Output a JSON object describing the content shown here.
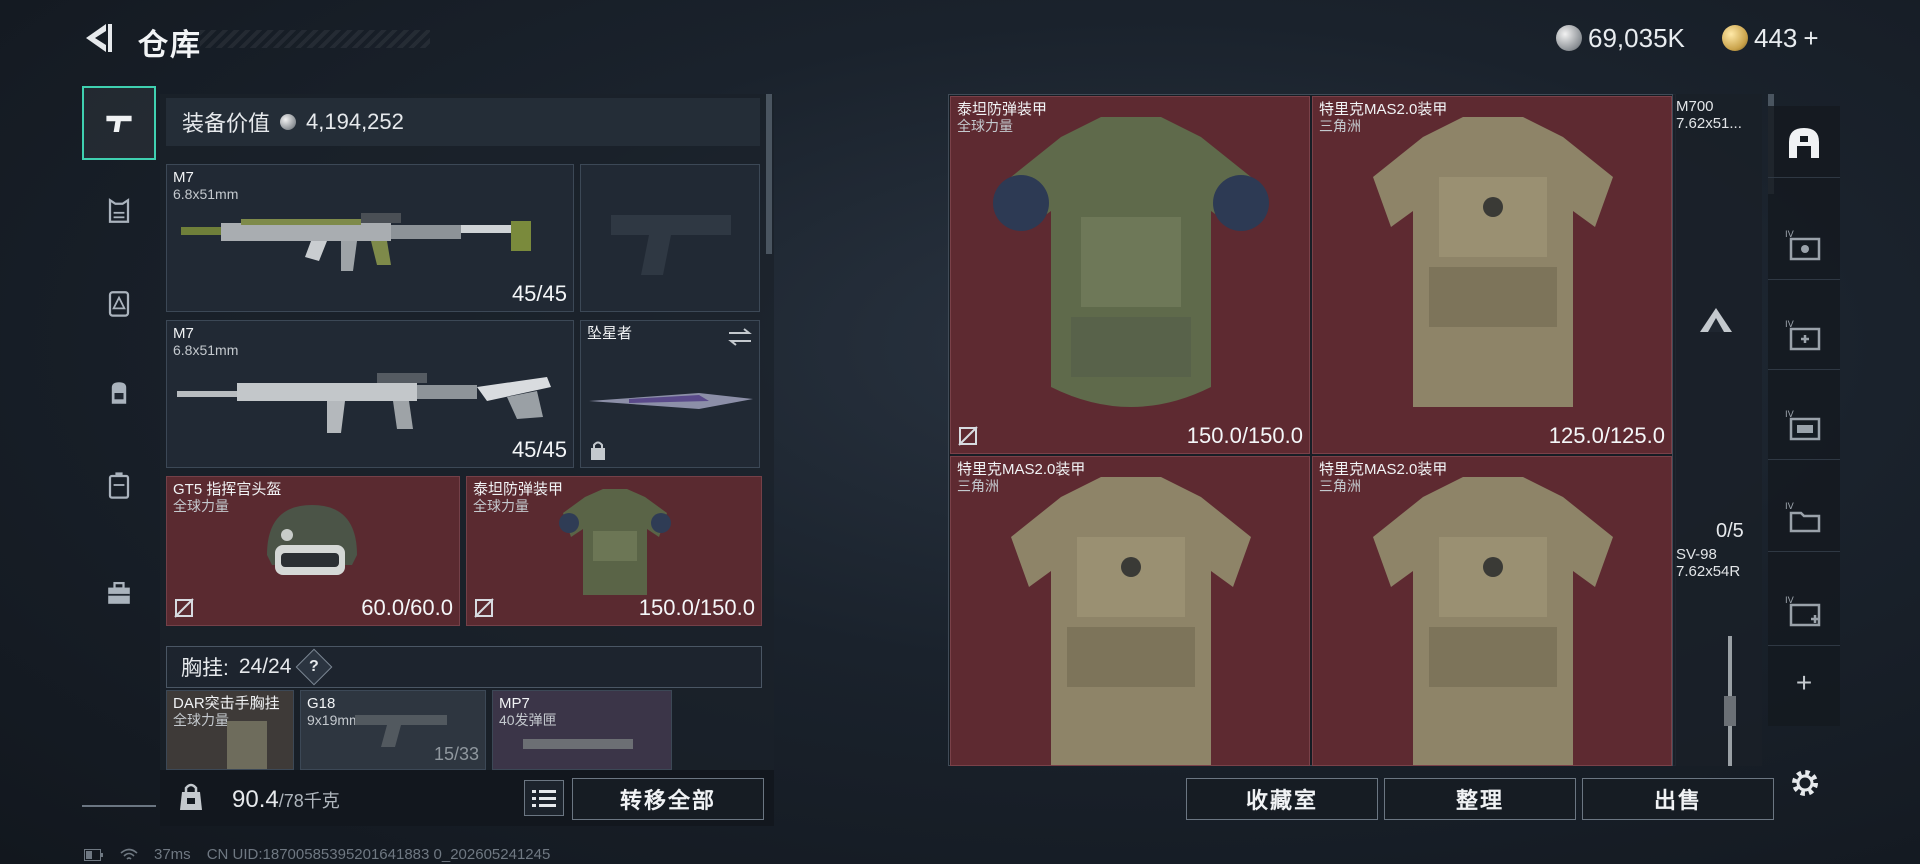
{
  "header": {
    "title": "仓库",
    "silver_currency": "69,035K",
    "gold_currency": "443",
    "gold_add": "+"
  },
  "nav": {
    "items": [
      {
        "name": "weapons",
        "active": true
      },
      {
        "name": "armor"
      },
      {
        "name": "vest"
      },
      {
        "name": "backpack"
      },
      {
        "name": "container"
      },
      {
        "name": "toolbox"
      }
    ]
  },
  "loadout": {
    "equip_value_label": "装备价值",
    "equip_value": "4,194,252",
    "primary1": {
      "name": "M7",
      "caliber": "6.8x51mm",
      "ammo": "45/45"
    },
    "primary2": {
      "name": "M7",
      "caliber": "6.8x51mm",
      "ammo": "45/45"
    },
    "melee": {
      "name": "坠星者"
    },
    "helmet": {
      "name": "GT5 指挥官头盔",
      "faction": "全球力量",
      "durability": "60.0/60.0"
    },
    "armor": {
      "name": "泰坦防弹装甲",
      "faction": "全球力量",
      "durability": "150.0/150.0"
    },
    "chest_rig_label": "胸挂:",
    "chest_rig_capacity": "24/24",
    "chest_rig_help": "?",
    "chest_items": [
      {
        "name": "DAR突击手胸挂",
        "sub": "全球力量"
      },
      {
        "name": "G18",
        "sub": "9x19mm",
        "ammo": "15/33"
      },
      {
        "name": "MP7",
        "sub": "40发弹匣"
      }
    ],
    "weight": "90.4",
    "weight_max": "/78千克",
    "transfer_all": "转移全部"
  },
  "storage": {
    "cells": [
      {
        "name": "泰坦防弹装甲",
        "sub": "全球力量",
        "durability": "150.0/150.0"
      },
      {
        "name": "特里克MAS2.0装甲",
        "sub": "三角洲",
        "durability": "125.0/125.0"
      },
      {
        "name": "特里克MAS2.0装甲",
        "sub": "三角洲"
      },
      {
        "name": "特里克MAS2.0装甲",
        "sub": "三角洲"
      }
    ],
    "side": {
      "item1_name": "M700",
      "item1_sub": "7.62x51...",
      "count": "0/5",
      "item2_name": "SV-98",
      "item2_sub": "7.62x54R"
    },
    "buttons": {
      "collection": "收藏室",
      "sort": "整理",
      "sell": "出售"
    },
    "add": "+"
  },
  "status": {
    "ping": "37ms",
    "uid": "CN UID:18700585395201641883 0_202605241245"
  }
}
